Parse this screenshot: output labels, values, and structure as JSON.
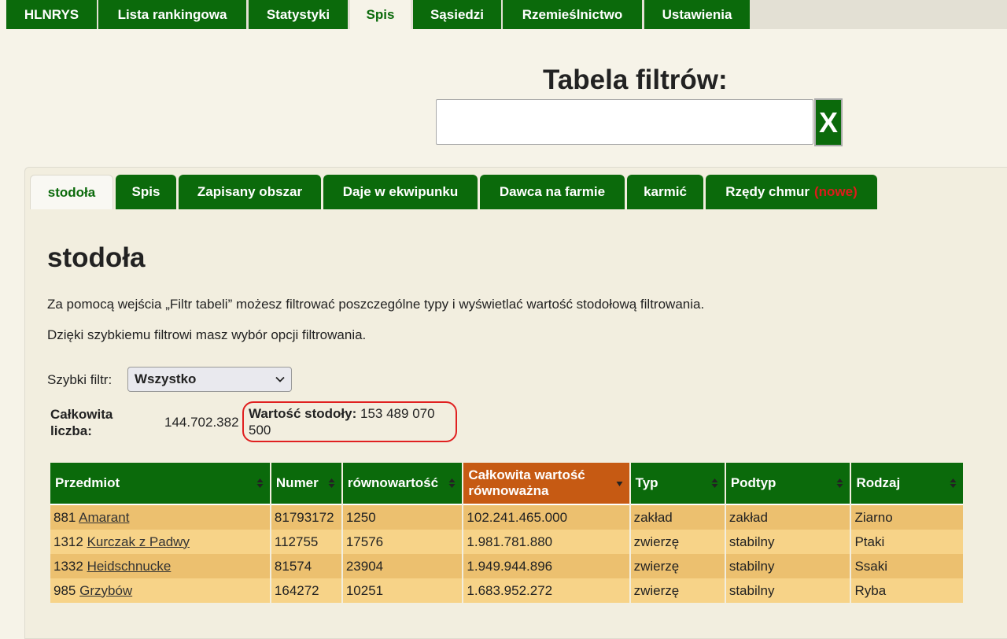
{
  "topnav": {
    "tabs": [
      {
        "label": "HLNRYS",
        "active": false
      },
      {
        "label": "Lista rankingowa",
        "active": false
      },
      {
        "label": "Statystyki",
        "active": false
      },
      {
        "label": "Spis",
        "active": true
      },
      {
        "label": "Sąsiedzi",
        "active": false
      },
      {
        "label": "Rzemieślnictwo",
        "active": false
      },
      {
        "label": "Ustawienia",
        "active": false
      }
    ]
  },
  "filter": {
    "title": "Tabela filtrów:",
    "input_value": "",
    "clear_label": "X"
  },
  "subtabs": [
    {
      "label": "stodoła",
      "active": true
    },
    {
      "label": "Spis",
      "active": false
    },
    {
      "label": "Zapisany obszar",
      "active": false
    },
    {
      "label": "Daje w ekwipunku",
      "active": false
    },
    {
      "label": "Dawca na farmie",
      "active": false
    },
    {
      "label": "karmić",
      "active": false
    },
    {
      "label": "Rzędy chmur",
      "badge": "(nowe)",
      "active": false
    }
  ],
  "main": {
    "heading": "stodoła",
    "para1": "Za pomocą wejścia „Filtr tabeli” możesz filtrować poszczególne typy i wyświetlać wartość stodołową filtrowania.",
    "para2": "Dzięki szybkiemu filtrowi masz wybór opcji filtrowania.",
    "quick_filter_label": "Szybki filtr:",
    "quick_filter_value": "Wszystko",
    "total_label": "Całkowita liczba:",
    "total_value": "144.702.382",
    "barn_label": "Wartość stodoły:",
    "barn_value": "153 489 070 500",
    "highlight_color": "#e02020"
  },
  "table": {
    "columns": [
      "Przedmiot",
      "Numer",
      "równowartość",
      "Całkowita wartość równoważna",
      "Typ",
      "Podtyp",
      "Rodzaj"
    ],
    "sorted_column": "Całkowita wartość równoważna",
    "rows": [
      {
        "id": "881",
        "name": "Amarant",
        "numer": "81793172",
        "rown": "1250",
        "total": "102.241.465.000",
        "typ": "zakład",
        "podtyp": "zakład",
        "rodzaj": "Ziarno"
      },
      {
        "id": "1312",
        "name": "Kurczak z Padwy",
        "numer": "112755",
        "rown": "17576",
        "total": "1.981.781.880",
        "typ": "zwierzę",
        "podtyp": "stabilny",
        "rodzaj": "Ptaki"
      },
      {
        "id": "1332",
        "name": "Heidschnucke",
        "numer": "81574",
        "rown": "23904",
        "total": "1.949.944.896",
        "typ": "zwierzę",
        "podtyp": "stabilny",
        "rodzaj": "Ssaki"
      },
      {
        "id": "985",
        "name": "Grzybów",
        "numer": "164272",
        "rown": "10251",
        "total": "1.683.952.272",
        "typ": "zwierzę",
        "podtyp": "stabilny",
        "rodzaj": "Ryba"
      }
    ]
  },
  "colors": {
    "brand_green": "#0b6a0b",
    "sorted_header": "#c65a13",
    "row_odd": "#ecc06f",
    "row_even": "#f7d388"
  }
}
